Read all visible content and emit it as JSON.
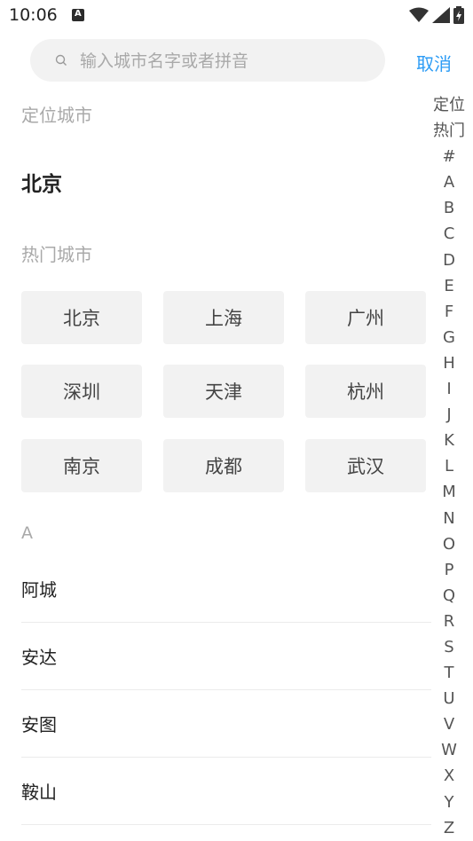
{
  "status_bar": {
    "time": "10:06"
  },
  "search": {
    "placeholder": "输入城市名字或者拼音",
    "value": "",
    "cancel_label": "取消"
  },
  "location": {
    "title": "定位城市",
    "city": "北京"
  },
  "hot": {
    "title": "热门城市",
    "cities": [
      "北京",
      "上海",
      "广州",
      "深圳",
      "天津",
      "杭州",
      "南京",
      "成都",
      "武汉"
    ]
  },
  "list": {
    "letter": "A",
    "cities": [
      "阿城",
      "安达",
      "安图",
      "鞍山"
    ]
  },
  "index": [
    "定位",
    "热门",
    "#",
    "A",
    "B",
    "C",
    "D",
    "E",
    "F",
    "G",
    "H",
    "I",
    "J",
    "K",
    "L",
    "M",
    "N",
    "O",
    "P",
    "Q",
    "R",
    "S",
    "T",
    "U",
    "V",
    "W",
    "X",
    "Y",
    "Z"
  ],
  "colors": {
    "accent": "#2d9cf5",
    "muted": "#a9a9a9",
    "chip_bg": "#f2f2f2"
  }
}
